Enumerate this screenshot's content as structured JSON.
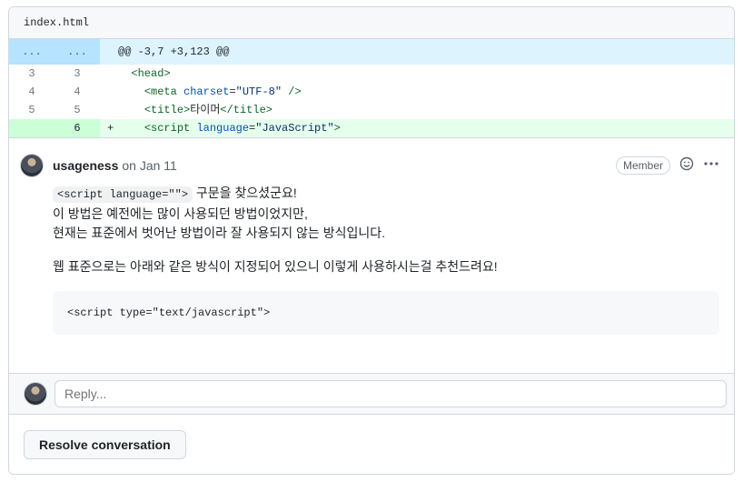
{
  "file": {
    "name": "index.html"
  },
  "diff": {
    "hunk": {
      "old": "...",
      "new": "...",
      "text": "@@ -3,7 +3,123 @@"
    },
    "rows": [
      {
        "old": "3",
        "new": "3",
        "marker": "",
        "parts": [
          {
            "t": "  "
          },
          {
            "c": "tag",
            "t": "<head>"
          }
        ]
      },
      {
        "old": "4",
        "new": "4",
        "marker": "",
        "parts": [
          {
            "t": "    "
          },
          {
            "c": "tag",
            "t": "<meta"
          },
          {
            "t": " "
          },
          {
            "c": "attr",
            "t": "charset"
          },
          {
            "t": "="
          },
          {
            "c": "str",
            "t": "\"UTF-8\""
          },
          {
            "c": "tag",
            "t": " />"
          }
        ]
      },
      {
        "old": "5",
        "new": "5",
        "marker": "",
        "parts": [
          {
            "t": "    "
          },
          {
            "c": "tag",
            "t": "<title>"
          },
          {
            "t": "타이머"
          },
          {
            "c": "tag",
            "t": "</title>"
          }
        ]
      },
      {
        "old": "",
        "new": "6",
        "marker": "+",
        "added": true,
        "parts": [
          {
            "t": "    "
          },
          {
            "c": "tag",
            "t": "<script"
          },
          {
            "t": " "
          },
          {
            "c": "attr",
            "t": "language"
          },
          {
            "t": "="
          },
          {
            "c": "str",
            "t": "\"JavaScript\""
          },
          {
            "c": "tag",
            "t": ">"
          }
        ]
      }
    ]
  },
  "comment": {
    "author": "usageness",
    "date": "on Jan 11",
    "badge": "Member",
    "inline_code": "<script language=\"\">",
    "line1_rest": " 구문을 찾으셨군요!",
    "line2": "이 방법은 예전에는 많이 사용되던 방법이었지만,",
    "line3": "현재는 표준에서 벗어난 방법이라 잘 사용되지 않는 방식입니다.",
    "line4": "웹 표준으로는 아래와 같은 방식이 지정되어 있으니 이렇게 사용하시는걸 추천드려요!",
    "code_block": "<script type=\"text/javascript\">"
  },
  "reply": {
    "placeholder": "Reply..."
  },
  "footer": {
    "resolve_label": "Resolve conversation"
  },
  "icons": {
    "emoji": "smiley-icon",
    "more": "kebab-horizontal-icon"
  }
}
